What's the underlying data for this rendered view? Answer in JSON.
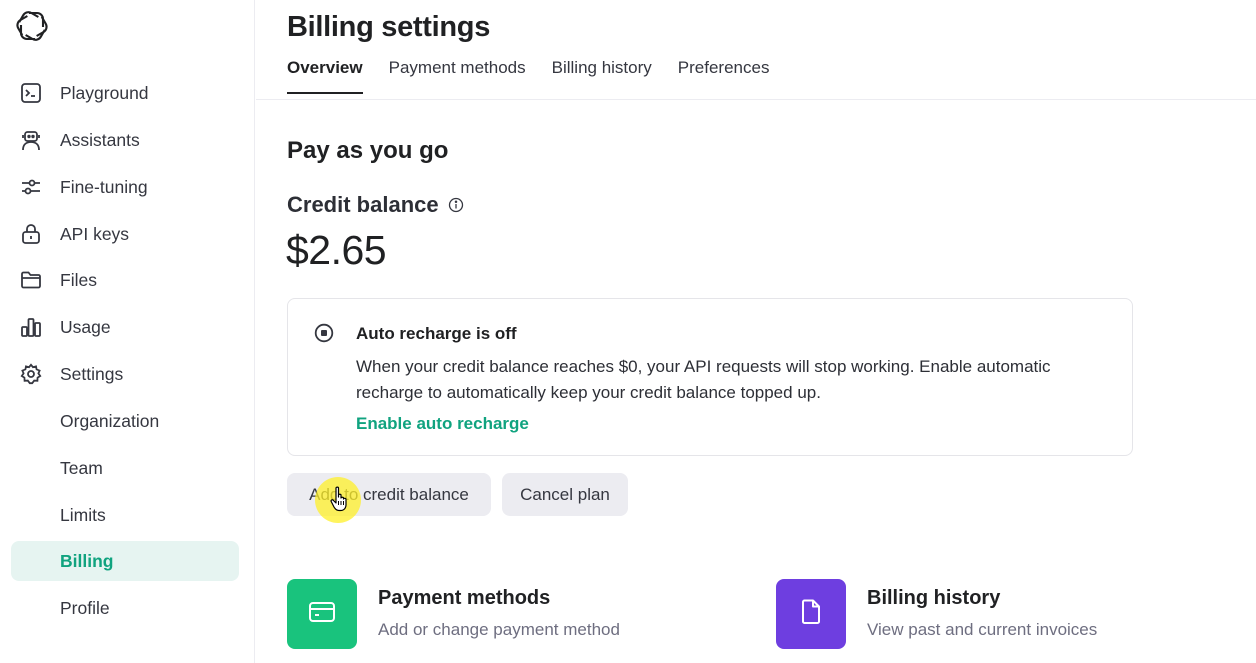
{
  "sidebar": {
    "items": [
      {
        "label": "Playground",
        "icon": "terminal-icon"
      },
      {
        "label": "Assistants",
        "icon": "robot-icon"
      },
      {
        "label": "Fine-tuning",
        "icon": "sliders-icon"
      },
      {
        "label": "API keys",
        "icon": "lock-icon"
      },
      {
        "label": "Files",
        "icon": "folder-icon"
      },
      {
        "label": "Usage",
        "icon": "bar-chart-icon"
      },
      {
        "label": "Settings",
        "icon": "gear-icon"
      },
      {
        "label": "Organization"
      },
      {
        "label": "Team"
      },
      {
        "label": "Limits"
      },
      {
        "label": "Billing",
        "active": true
      },
      {
        "label": "Profile"
      }
    ]
  },
  "header": {
    "title": "Billing settings",
    "tabs": [
      {
        "label": "Overview",
        "active": true
      },
      {
        "label": "Payment methods"
      },
      {
        "label": "Billing history"
      },
      {
        "label": "Preferences"
      }
    ]
  },
  "main": {
    "section_title": "Pay as you go",
    "credit_label": "Credit balance",
    "balance": "$2.65",
    "auto_recharge": {
      "title": "Auto recharge is off",
      "description": "When your credit balance reaches $0, your API requests will stop working. Enable automatic recharge to automatically keep your credit balance topped up.",
      "link": "Enable auto recharge"
    },
    "buttons": {
      "add": "Add to credit balance",
      "cancel": "Cancel plan"
    },
    "cards": [
      {
        "title": "Payment methods",
        "subtitle": "Add or change payment method",
        "color": "#19c37d",
        "icon": "credit-card-icon"
      },
      {
        "title": "Billing history",
        "subtitle": "View past and current invoices",
        "color": "#6e3ee0",
        "icon": "document-icon"
      }
    ]
  },
  "colors": {
    "accent": "#10a37f",
    "active_bg": "#e6f4f1",
    "button_bg": "#ececf1"
  }
}
